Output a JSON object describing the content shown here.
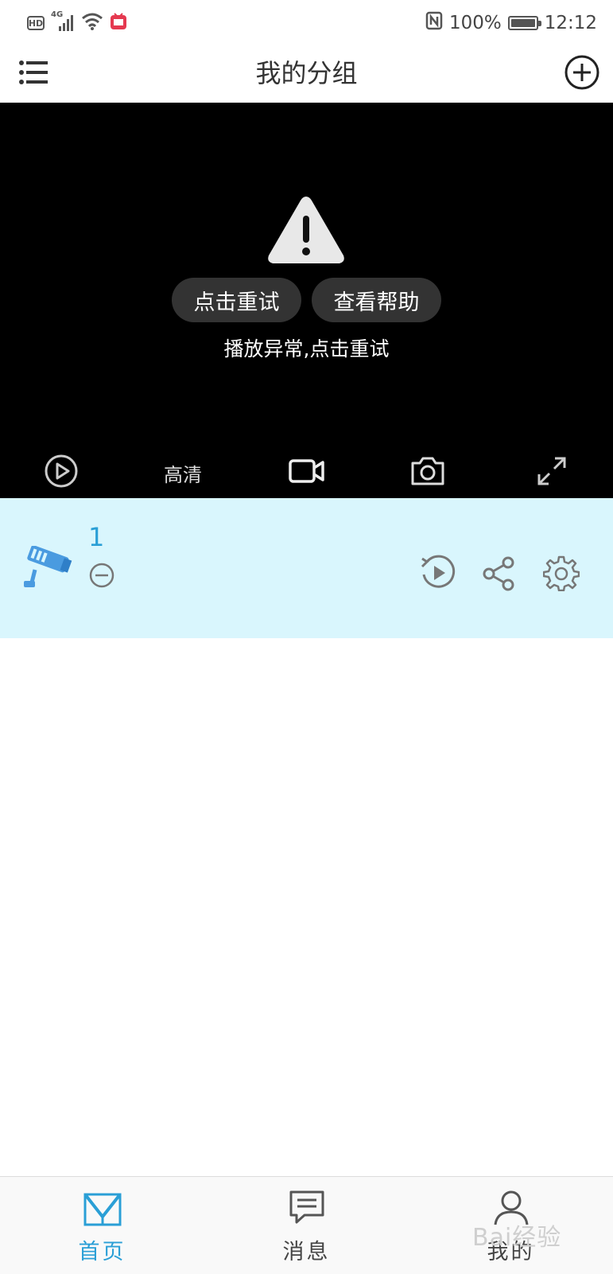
{
  "status_bar": {
    "hd_label": "HD",
    "network_label": "4G",
    "battery_text": "100%",
    "time": "12:12",
    "battery_level": 1.0
  },
  "header": {
    "title": "我的分组",
    "menu_icon": "list-icon",
    "add_icon": "plus-circle-icon"
  },
  "player": {
    "retry_button": "点击重试",
    "help_button": "查看帮助",
    "message": "播放异常,点击重试",
    "quality_label": "高清",
    "icons": [
      "play-circle-icon",
      "video-camera-icon",
      "camera-icon",
      "fullscreen-icon"
    ]
  },
  "device": {
    "name": "1",
    "icons": [
      "cctv-camera-icon",
      "minus-circle-icon",
      "playback-icon",
      "share-icon",
      "gear-icon"
    ]
  },
  "bottom_nav": {
    "items": [
      {
        "label": "首页",
        "icon": "home-m-icon",
        "active": true
      },
      {
        "label": "消息",
        "icon": "message-icon",
        "active": false
      },
      {
        "label": "我的",
        "icon": "user-icon",
        "active": false
      }
    ]
  },
  "colors": {
    "accent": "#2a9fd6",
    "card_bg": "#d9f6fd",
    "player_bg": "#000000"
  },
  "watermark": "Bai经验"
}
